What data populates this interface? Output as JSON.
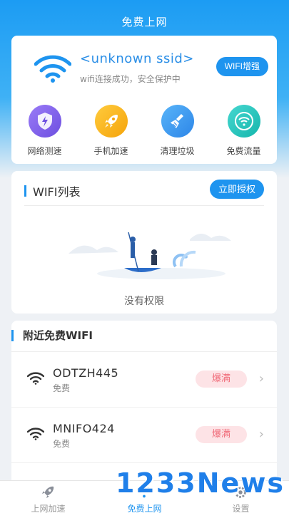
{
  "app": {
    "title": "免费上网"
  },
  "connection": {
    "ssid": "<unknown ssid>",
    "status": "wifi连接成功，安全保护中",
    "boost_label": "WIFI增强"
  },
  "features": [
    {
      "label": "网络测速",
      "icon": "shield-lightning-icon",
      "color": "#7b5cec"
    },
    {
      "label": "手机加速",
      "icon": "rocket-icon",
      "color": "#f7b21c"
    },
    {
      "label": "清理垃圾",
      "icon": "broom-icon",
      "color": "#3a95ee"
    },
    {
      "label": "免费流量",
      "icon": "wifi-icon",
      "color": "#1fc1b7"
    }
  ],
  "wifi_list": {
    "title": "WIFI列表",
    "auth_label": "立即授权",
    "empty_text": "没有权限"
  },
  "nearby": {
    "title": "附近免费WIFI",
    "items": [
      {
        "name": "ODTZH445",
        "sub": "免费",
        "badge": "爆满"
      },
      {
        "name": "MNIFO424",
        "sub": "免费",
        "badge": "爆满"
      }
    ]
  },
  "tabs": [
    {
      "label": "上网加速",
      "icon": "rocket-icon"
    },
    {
      "label": "免费上网",
      "icon": "wifi-icon",
      "active": true
    },
    {
      "label": "设置",
      "icon": "gear-icon"
    }
  ],
  "watermark": "1233News",
  "colors": {
    "accent": "#1e94ef",
    "badge_bg": "#fde3e6",
    "badge_text": "#f06a78"
  }
}
